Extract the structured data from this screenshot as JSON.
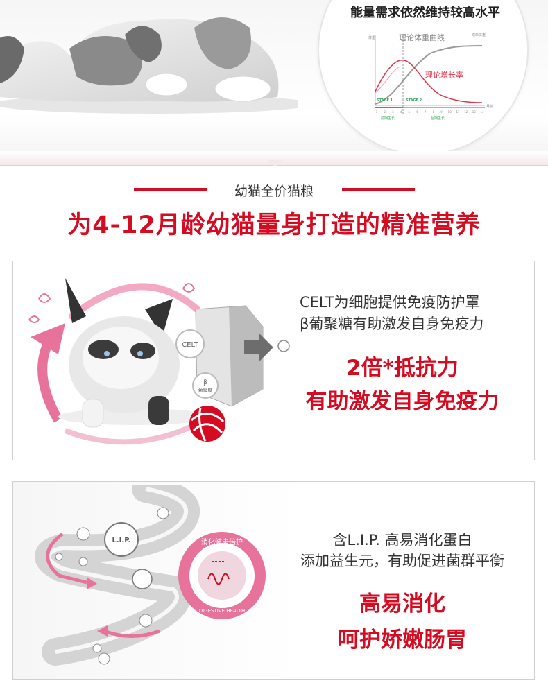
{
  "hero": {
    "energy_title": "能量需求依然维持较高水平",
    "chart": {
      "weight_curve_label": "理论体重曲线",
      "growth_rate_label": "理论增长率",
      "y_left_label": "体重",
      "y_right_label": "成年体重",
      "x_label": "月龄",
      "stage1": "STAGE 1",
      "stage2": "STAGE 2",
      "stage1_sub": "前期生长",
      "stage2_sub": "后期生长",
      "x_ticks": [
        "1",
        "2",
        "3",
        "4",
        "5",
        "6",
        "7",
        "8",
        "9",
        "10",
        "11",
        "12",
        "13",
        "14"
      ]
    }
  },
  "section": {
    "sub_label": "幼猫全价猫粮",
    "title": "为4-12月龄幼猫量身打造的精准营养"
  },
  "panel1": {
    "line1": "CELT为细胞提供免疫防护罩",
    "line2": "β葡聚糖有助激发自身免疫力",
    "big1": "2倍*抵抗力",
    "big2": "有助激发自身免疫力",
    "badge_celt": "CELT",
    "badge_beta": "β",
    "badge_beta_sub": "葡聚糖"
  },
  "panel2": {
    "line1": "含L.I.P. 高易消化蛋白",
    "line2": "添加益生元，有助促进菌群平衡",
    "big1": "高易消化",
    "big2": "呵护娇嫩肠胃",
    "badge_lip": "L.I.P.",
    "ring_top": "消化健康倍护",
    "ring_bottom": "DIGESTIVE HEALTH"
  },
  "colors": {
    "brand_red": "#d40b21",
    "pink": "#e8739a",
    "chart_green": "#3aa35b",
    "chart_red": "#e0334a"
  }
}
